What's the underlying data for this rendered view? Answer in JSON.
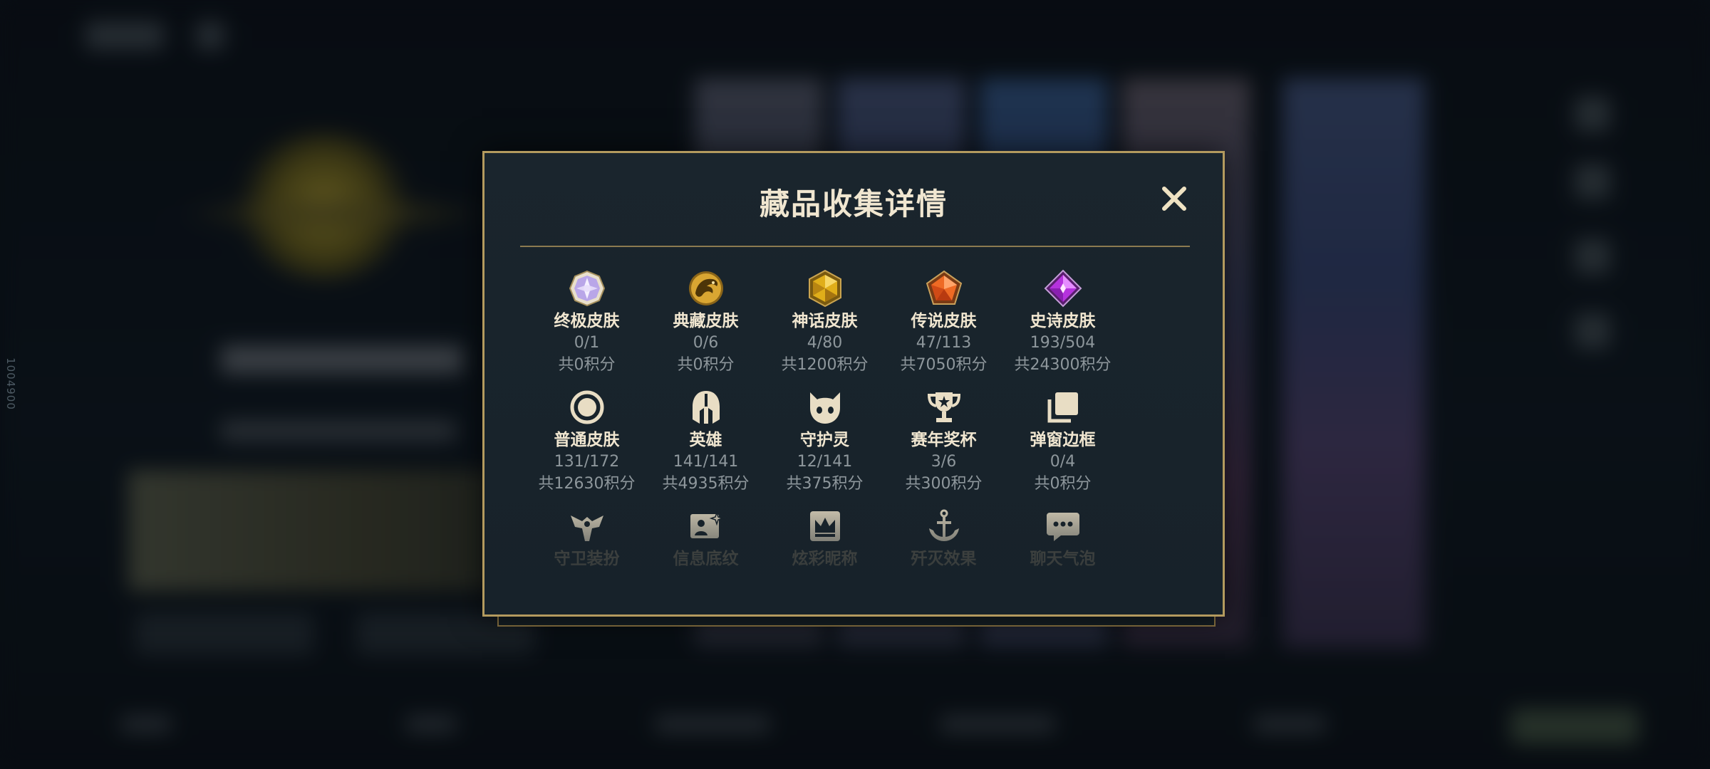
{
  "background": {
    "side_id": "1004900"
  },
  "modal": {
    "title": "藏品收集详情",
    "close_icon": "close-icon"
  },
  "categories": [
    {
      "label": "终极皮肤",
      "count": "0/1",
      "points": "共0积分",
      "icon": "ultimate-skin-gem-icon"
    },
    {
      "label": "典藏皮肤",
      "count": "0/6",
      "points": "共0积分",
      "icon": "prestige-skin-dragon-icon"
    },
    {
      "label": "神话皮肤",
      "count": "4/80",
      "points": "共1200积分",
      "icon": "mythic-skin-gem-icon"
    },
    {
      "label": "传说皮肤",
      "count": "47/113",
      "points": "共7050积分",
      "icon": "legendary-skin-gem-icon"
    },
    {
      "label": "史诗皮肤",
      "count": "193/504",
      "points": "共24300积分",
      "icon": "epic-skin-gem-icon"
    },
    {
      "label": "普通皮肤",
      "count": "131/172",
      "points": "共12630积分",
      "icon": "common-skin-ring-icon"
    },
    {
      "label": "英雄",
      "count": "141/141",
      "points": "共4935积分",
      "icon": "champion-helmet-icon"
    },
    {
      "label": "守护灵",
      "count": "12/141",
      "points": "共375积分",
      "icon": "guardian-spirit-icon"
    },
    {
      "label": "赛年奖杯",
      "count": "3/6",
      "points": "共300积分",
      "icon": "trophy-icon"
    },
    {
      "label": "弹窗边框",
      "count": "0/4",
      "points": "共0积分",
      "icon": "popup-frame-icon"
    },
    {
      "label": "守卫装扮",
      "icon": "ward-skin-icon"
    },
    {
      "label": "信息底纹",
      "icon": "profile-banner-icon"
    },
    {
      "label": "炫彩昵称",
      "icon": "nickname-crown-icon"
    },
    {
      "label": "歼灭效果",
      "icon": "elimination-effect-icon"
    },
    {
      "label": "聊天气泡",
      "icon": "chat-bubble-icon"
    }
  ]
}
